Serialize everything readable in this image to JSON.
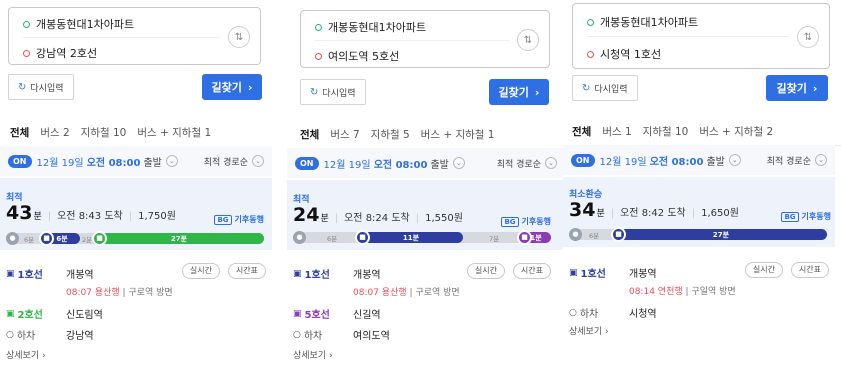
{
  "panels": [
    {
      "origin": "개봉동현대1차아파트",
      "destination": "강남역 2호선",
      "reset_label": "다시입력",
      "find_label": "길찾기",
      "tabs": [
        "전체",
        "버스 2",
        "지하철 10",
        "버스 + 지하철 1"
      ],
      "options": {
        "on": "ON",
        "date": "12월 19일",
        "time": "오전 08:00",
        "depart": "출발",
        "sort": "최적 경로순"
      },
      "route": {
        "label": "최적",
        "minutes": "43",
        "unit": "분",
        "arrival": "오전 8:43 도착",
        "fare": "1,750원",
        "badge": "기후동행",
        "badge_box": "BG",
        "bar_labels": [
          "6분",
          "6분",
          "2분",
          "27분"
        ],
        "bar_colors": [
          "#2f3e9e",
          "#2fb548"
        ],
        "bar_fractions": [
          0.15,
          0.14,
          0.05,
          0.66
        ],
        "steps": [
          {
            "line": "1호선",
            "color": "#2f3e9e",
            "station": "개봉역",
            "detail_red": "08:07 용산행",
            "detail_grey": "구로역 방면"
          },
          {
            "line": "2호선",
            "color": "#2fb548",
            "station": "신도림역"
          },
          {
            "line": "하차",
            "color": "#666",
            "station": "강남역"
          }
        ],
        "pill1": "실시간",
        "pill2": "시간표",
        "more": "상세보기"
      }
    },
    {
      "origin": "개봉동현대1차아파트",
      "destination": "여의도역 5호선",
      "reset_label": "다시입력",
      "find_label": "길찾기",
      "tabs": [
        "전체",
        "버스 7",
        "지하철 5",
        "버스 + 지하철 1"
      ],
      "options": {
        "on": "ON",
        "date": "12월 19일",
        "time": "오전 08:00",
        "depart": "출발",
        "sort": "최적 경로순"
      },
      "route": {
        "label": "최적",
        "minutes": "24",
        "unit": "분",
        "arrival": "오전 8:24 도착",
        "fare": "1,550원",
        "badge": "기후동행",
        "badge_box": "BG",
        "bar_labels": [
          "6분",
          "11분",
          "7분",
          "1분"
        ],
        "bar_colors": [
          "#2f3e9e",
          "#8a3db0"
        ],
        "bar_fractions": [
          0.24,
          0.44,
          0.28,
          0.04
        ],
        "steps": [
          {
            "line": "1호선",
            "color": "#2f3e9e",
            "station": "개봉역",
            "detail_red": "08:07 용산행",
            "detail_grey": "구로역 방면"
          },
          {
            "line": "5호선",
            "color": "#8a3db0",
            "station": "신길역"
          },
          {
            "line": "하차",
            "color": "#666",
            "station": "여의도역"
          }
        ],
        "pill1": "실시간",
        "pill2": "시간표",
        "more": "상세보기"
      }
    },
    {
      "origin": "개봉동현대1차아파트",
      "destination": "시청역 1호선",
      "reset_label": "다시입력",
      "find_label": "길찾기",
      "tabs": [
        "전체",
        "버스 1",
        "지하철 10",
        "버스 + 지하철 2"
      ],
      "options": {
        "on": "ON",
        "date": "12월 19일",
        "time": "오전 08:00",
        "depart": "출발",
        "sort": "최적 경로순"
      },
      "route": {
        "label": "최소환승",
        "minutes": "34",
        "unit": "분",
        "arrival": "오전 8:42 도착",
        "fare": "1,650원",
        "badge": "기후동행",
        "badge_box": "BG",
        "bar_labels": [
          "6분",
          "27분"
        ],
        "bar_colors": [
          "#2f3e9e"
        ],
        "bar_fractions": [
          0.2,
          0.8
        ],
        "steps": [
          {
            "line": "1호선",
            "color": "#2f3e9e",
            "station": "개봉역",
            "detail_red": "08:14 연천행",
            "detail_grey": "구일역 방면"
          },
          {
            "line": "하차",
            "color": "#666",
            "station": "시청역"
          }
        ],
        "pill1": "실시간",
        "pill2": "시간표",
        "more": "상세보기"
      }
    }
  ]
}
